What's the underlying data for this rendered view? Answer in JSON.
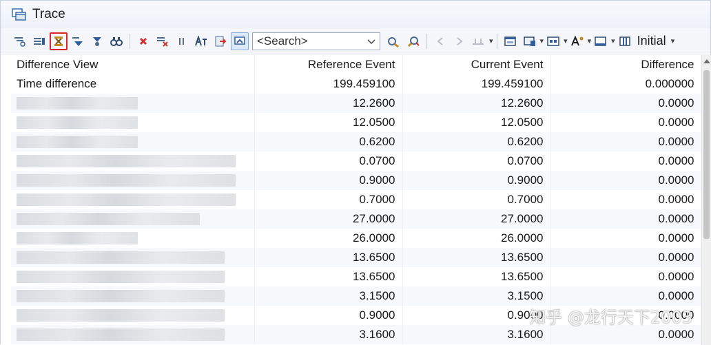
{
  "window": {
    "title": "Trace"
  },
  "toolbar": {
    "search_placeholder": "<Search>",
    "initial_label": "Initial"
  },
  "table": {
    "headers": [
      "Difference View",
      "Reference Event",
      "Current Event",
      "Difference"
    ],
    "rows": [
      {
        "label": "Time difference",
        "ref": "199.459100",
        "cur": "199.459100",
        "diff": "0.000000"
      },
      {
        "label": "",
        "ref": "12.2600",
        "cur": "12.2600",
        "diff": "0.0000"
      },
      {
        "label": "",
        "ref": "12.0500",
        "cur": "12.0500",
        "diff": "0.0000"
      },
      {
        "label": "",
        "ref": "0.6200",
        "cur": "0.6200",
        "diff": "0.0000"
      },
      {
        "label": "",
        "ref": "0.0700",
        "cur": "0.0700",
        "diff": "0.0000"
      },
      {
        "label": "",
        "ref": "0.9000",
        "cur": "0.9000",
        "diff": "0.0000"
      },
      {
        "label": "",
        "ref": "0.7000",
        "cur": "0.7000",
        "diff": "0.0000"
      },
      {
        "label": "",
        "ref": "27.0000",
        "cur": "27.0000",
        "diff": "0.0000"
      },
      {
        "label": "",
        "ref": "26.0000",
        "cur": "26.0000",
        "diff": "0.0000"
      },
      {
        "label": "",
        "ref": "13.6500",
        "cur": "13.6500",
        "diff": "0.0000"
      },
      {
        "label": "",
        "ref": "13.6500",
        "cur": "13.6500",
        "diff": "0.0000"
      },
      {
        "label": "",
        "ref": "3.1500",
        "cur": "3.1500",
        "diff": "0.0000"
      },
      {
        "label": "",
        "ref": "0.9000",
        "cur": "0.9000",
        "diff": "0.0000"
      },
      {
        "label": "",
        "ref": "3.1600",
        "cur": "3.1600",
        "diff": "0.0000"
      }
    ]
  },
  "watermark": "知乎 @龙行天下2003"
}
